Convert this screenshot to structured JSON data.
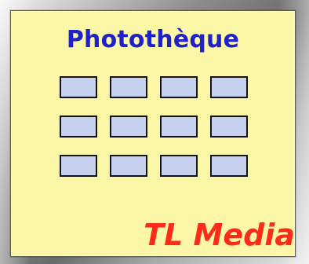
{
  "app": {
    "title": "Photothèque",
    "brand": "TL Media"
  },
  "gallery": {
    "rows": 3,
    "cols": 4,
    "thumb_fill": "#c8d0f0",
    "thumb_border": "#111111"
  },
  "colors": {
    "panel_bg": "#fbf7a6",
    "title": "#2020c8",
    "brand": "#ff2a1a"
  }
}
